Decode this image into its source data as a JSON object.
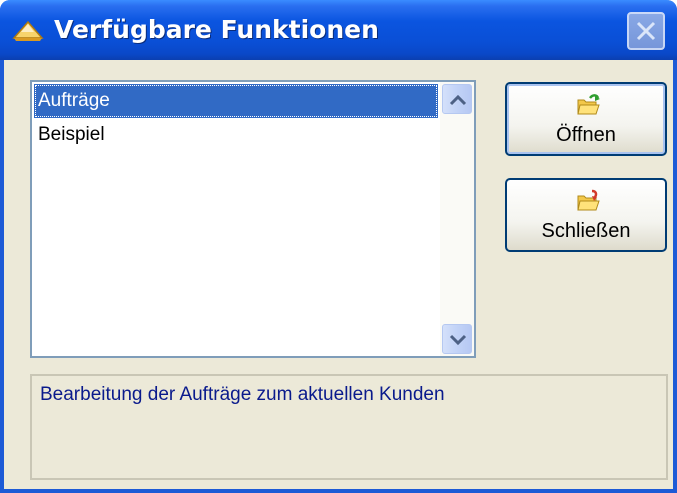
{
  "window": {
    "title": "Verfügbare Funktionen",
    "title_icon": "app-icon",
    "close_icon": "close-icon"
  },
  "functions_list": {
    "items": [
      {
        "label": "Aufträge",
        "selected": true
      },
      {
        "label": "Beispiel",
        "selected": false
      }
    ]
  },
  "buttons": {
    "open": {
      "label": "Öffnen",
      "icon": "folder-open-icon"
    },
    "close": {
      "label": "Schließen",
      "icon": "folder-close-icon"
    }
  },
  "description": {
    "text": "Bearbeitung der Aufträge zum aktuellen Kunden"
  },
  "colors": {
    "titlebar": "#0a4fd6",
    "window_bg": "#ece9d8",
    "selection": "#316ac5",
    "description_text": "#0a1a8c"
  }
}
